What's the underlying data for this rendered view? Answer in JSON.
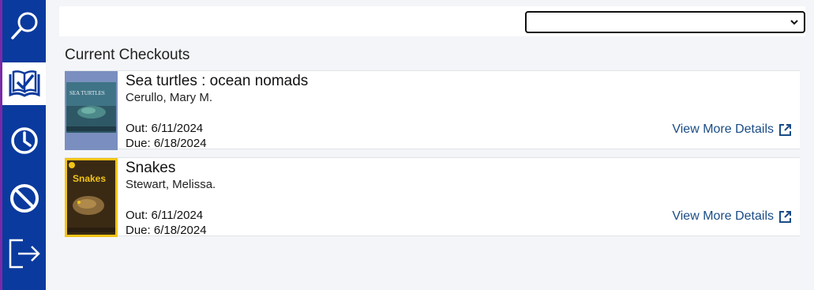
{
  "sidebar": {
    "items": [
      {
        "name": "search",
        "icon": "search-icon",
        "active": false
      },
      {
        "name": "checkouts",
        "icon": "book-check-icon",
        "active": true
      },
      {
        "name": "history",
        "icon": "clock-icon",
        "active": false
      },
      {
        "name": "blocks",
        "icon": "prohibited-icon",
        "active": false
      },
      {
        "name": "logout",
        "icon": "logout-icon",
        "active": false
      }
    ]
  },
  "topbar": {
    "select_value": ""
  },
  "section": {
    "heading": "Current Checkouts"
  },
  "checkouts": [
    {
      "title": "Sea turtles : ocean nomads",
      "author": "Cerullo, Mary M.",
      "out": "Out: 6/11/2024",
      "due": "Due: 6/18/2024",
      "link": "View More Details"
    },
    {
      "title": "Snakes",
      "author": "Stewart, Melissa.",
      "out": "Out: 6/11/2024",
      "due": "Due: 6/18/2024",
      "link": "View More Details"
    }
  ],
  "colors": {
    "sidebar": "#0a3a9e",
    "link": "#1a4c86",
    "accent_edge": "#7a2aa8",
    "background": "#f4f5f8"
  }
}
